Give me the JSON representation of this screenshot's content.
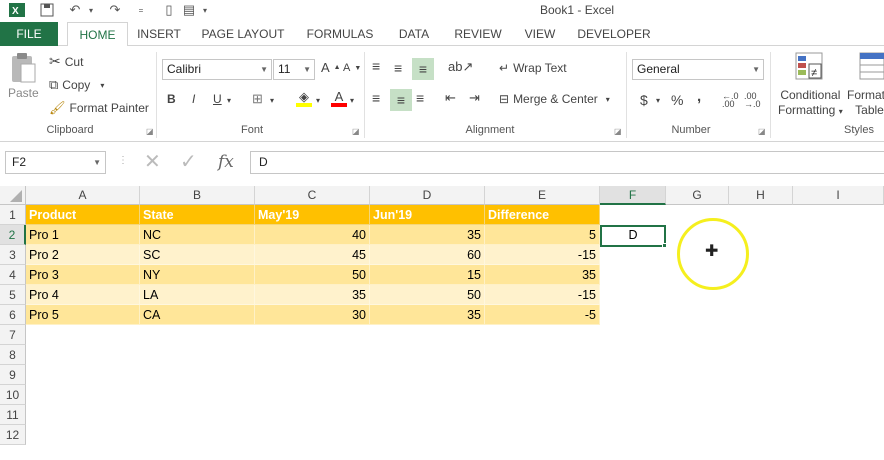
{
  "window": {
    "title": "Book1 - Excel"
  },
  "tabs": [
    {
      "label": "FILE"
    },
    {
      "label": "HOME"
    },
    {
      "label": "INSERT"
    },
    {
      "label": "PAGE LAYOUT"
    },
    {
      "label": "FORMULAS"
    },
    {
      "label": "DATA"
    },
    {
      "label": "REVIEW"
    },
    {
      "label": "VIEW"
    },
    {
      "label": "DEVELOPER"
    }
  ],
  "ribbon": {
    "clipboard": {
      "paste": "Paste",
      "cut": "Cut",
      "copy": "Copy",
      "format_painter": "Format Painter",
      "label": "Clipboard"
    },
    "font": {
      "name": "Calibri",
      "size": "11",
      "bold": "B",
      "italic": "I",
      "underline": "U",
      "label": "Font"
    },
    "alignment": {
      "wrap_text": "Wrap Text",
      "merge_center": "Merge & Center",
      "label": "Alignment"
    },
    "number": {
      "format": "General",
      "currency": "$",
      "percent": "%",
      "comma": ",",
      "inc_dec": "←.0\n.00",
      "label": "Number"
    },
    "styles": {
      "conditional_1": "Conditional",
      "conditional_2": "Formatting",
      "format_1": "Format",
      "format_2": "Table",
      "label": "Styles"
    }
  },
  "formula_bar": {
    "name_box": "F2",
    "fx": "fx",
    "content": "D"
  },
  "columns": [
    "A",
    "B",
    "C",
    "D",
    "E",
    "F",
    "G",
    "H",
    "I"
  ],
  "rows": [
    "1",
    "2",
    "3",
    "4",
    "5",
    "6",
    "7",
    "8",
    "9",
    "10",
    "11",
    "12"
  ],
  "table": {
    "headers": [
      "Product",
      "State",
      "May'19",
      "Jun'19",
      "Difference"
    ],
    "rows": [
      [
        "Pro 1",
        "NC",
        "40",
        "35",
        "5"
      ],
      [
        "Pro 2",
        "SC",
        "45",
        "60",
        "-15"
      ],
      [
        "Pro 3",
        "NY",
        "50",
        "15",
        "35"
      ],
      [
        "Pro 4",
        "LA",
        "35",
        "50",
        "-15"
      ],
      [
        "Pro 5",
        "CA",
        "30",
        "35",
        "-5"
      ]
    ]
  },
  "active_cell": {
    "value": "D"
  },
  "colors": {
    "accent": "#217346",
    "table_header": "#ffc000",
    "band_dark": "#ffe699",
    "band_light": "#fff2cc",
    "cursor_ring": "#f5ef1e"
  }
}
